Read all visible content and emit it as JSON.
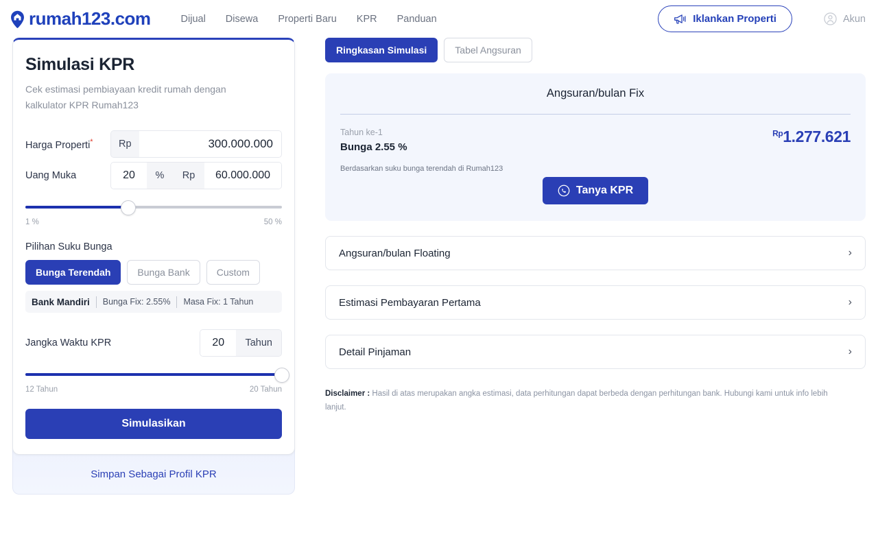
{
  "header": {
    "logo_text": "rumah123.com",
    "logo_icon": "map-pin-house-icon",
    "nav": [
      {
        "label": "Dijual"
      },
      {
        "label": "Disewa"
      },
      {
        "label": "Properti Baru"
      },
      {
        "label": "KPR"
      },
      {
        "label": "Panduan"
      }
    ],
    "advertise_button": "Iklankan Properti",
    "advertise_icon": "megaphone-icon",
    "account_label": "Akun",
    "account_icon": "user-circle-icon"
  },
  "form": {
    "title": "Simulasi KPR",
    "subtitle": "Cek estimasi pembiayaan kredit rumah dengan kalkulator KPR Rumah123",
    "harga": {
      "label": "Harga Properti",
      "required_mark": "*",
      "currency_prefix": "Rp",
      "value": "300.000.000"
    },
    "uang_muka": {
      "label": "Uang Muka",
      "percent_value": "20",
      "percent_symbol": "%",
      "currency_prefix": "Rp",
      "value": "60.000.000"
    },
    "dp_slider": {
      "min_label": "1 %",
      "max_label": "50 %",
      "fill_percent": 40
    },
    "suku_bunga": {
      "label": "Pilihan Suku Bunga",
      "options": [
        {
          "label": "Bunga Terendah",
          "active": true
        },
        {
          "label": "Bunga Bank",
          "active": false
        },
        {
          "label": "Custom",
          "active": false
        }
      ]
    },
    "bank_info": {
      "bank_name": "Bank Mandiri",
      "bunga_fix": "Bunga Fix: 2.55%",
      "masa_fix": "Masa Fix: 1 Tahun"
    },
    "jangka": {
      "label": "Jangka Waktu KPR",
      "value": "20",
      "unit": "Tahun"
    },
    "tenor_slider": {
      "min_label": "12 Tahun",
      "max_label": "20 Tahun",
      "fill_percent": 100
    },
    "submit_button": "Simulasikan",
    "save_profile_link": "Simpan Sebagai Profil KPR"
  },
  "results": {
    "tabs": [
      {
        "label": "Ringkasan Simulasi",
        "active": true
      },
      {
        "label": "Tabel Angsuran",
        "active": false
      }
    ],
    "summary": {
      "title": "Angsuran/bulan Fix",
      "year_label": "Tahun ke-1",
      "bunga_label": "Bunga 2.55 %",
      "note": "Berdasarkan suku bunga terendah di Rumah123",
      "currency_sup": "Rp",
      "amount": "1.277.621",
      "cta_label": "Tanya KPR",
      "cta_icon": "whatsapp-icon"
    },
    "accordions": [
      {
        "label": "Angsuran/bulan Floating",
        "chevron": "›"
      },
      {
        "label": "Estimasi Pembayaran Pertama",
        "chevron": "›"
      },
      {
        "label": "Detail Pinjaman",
        "chevron": "›"
      }
    ],
    "disclaimer_label": "Disclaimer :",
    "disclaimer_text": " Hasil di atas merupakan angka estimasi, data perhitungan dapat berbeda dengan perhitungan bank. Hubungi kami untuk info lebih lanjut."
  },
  "colors": {
    "brand_blue": "#2a3fb5",
    "logo_blue": "#1f41bb",
    "summary_bg": "#f3f6fd",
    "required_red": "#e0392b"
  }
}
